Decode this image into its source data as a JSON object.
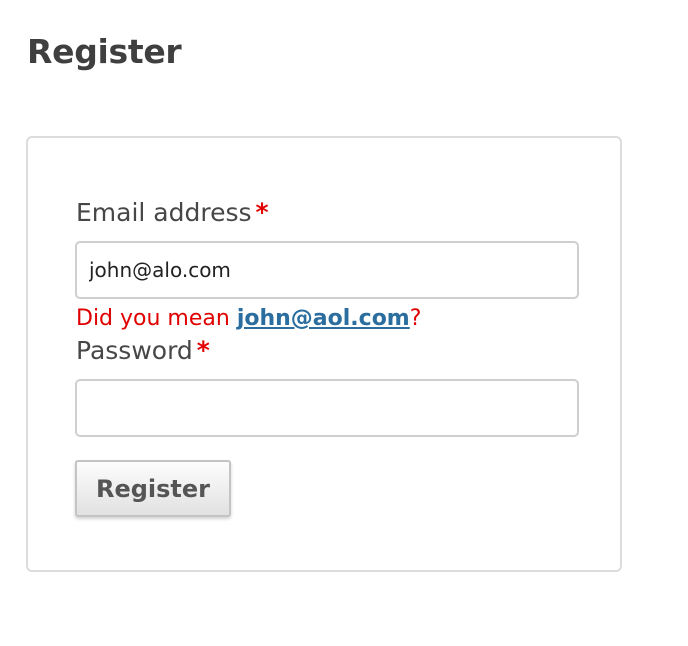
{
  "page": {
    "title": "Register"
  },
  "form": {
    "email": {
      "label": "Email address",
      "required_mark": "*",
      "value": "john@alo.com"
    },
    "suggestion": {
      "prefix": "Did you mean ",
      "suggested_email": "john@aol.com",
      "suffix": "?"
    },
    "password": {
      "label": "Password",
      "required_mark": "*",
      "value": ""
    },
    "submit_label": "Register"
  },
  "colors": {
    "error_text": "#e00000",
    "link": "#2a6d9e",
    "required_star": "#e30000"
  }
}
